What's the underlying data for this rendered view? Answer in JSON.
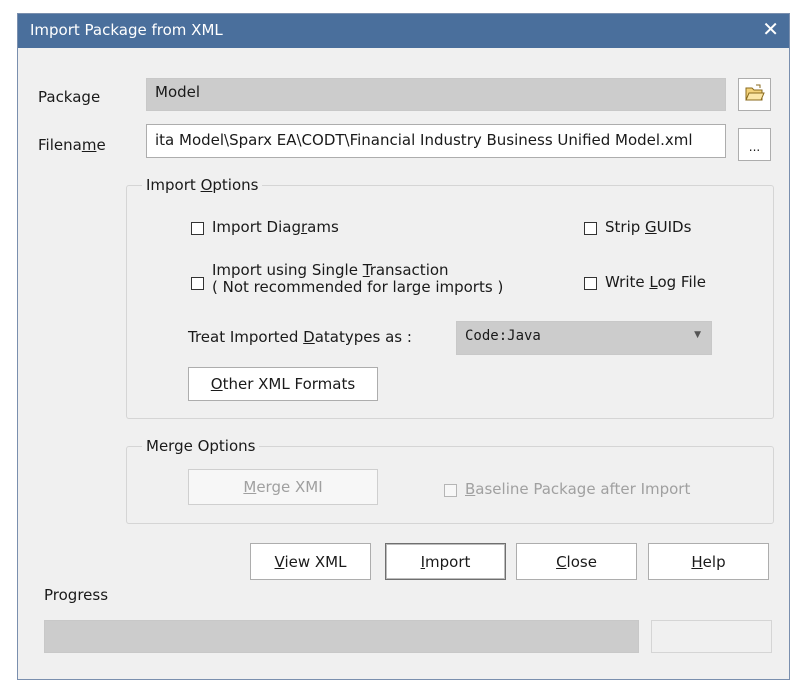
{
  "window": {
    "title": "Import Package from XML",
    "close_glyph": "✕"
  },
  "package": {
    "label": "Package",
    "value": "Model"
  },
  "filename": {
    "label_pre": "Filena",
    "label_u": "m",
    "label_post": "e",
    "value": "ita Model\\Sparx EA\\CODT\\Financial Industry Business Unified Model.xml",
    "browse_label": "..."
  },
  "import_options": {
    "title_pre": "Import ",
    "title_u": "O",
    "title_post": "ptions",
    "import_diagrams": {
      "pre": "Import Diag",
      "u": "r",
      "post": "ams",
      "checked": false
    },
    "strip_guids": {
      "pre": "Strip ",
      "u": "G",
      "post": "UIDs",
      "checked": false
    },
    "single_transaction": {
      "pre": "Import using Single ",
      "u": "T",
      "post": "ransaction",
      "line2": "( Not recommended for large imports )",
      "checked": false
    },
    "write_log": {
      "pre": "Write ",
      "u": "L",
      "post": "og File",
      "checked": false
    },
    "datatypes_label": {
      "pre": "Treat Imported ",
      "u": "D",
      "post": "atatypes as :"
    },
    "datatypes_value": "Code:Java",
    "other_formats": {
      "u": "O",
      "post": "ther XML Formats"
    }
  },
  "merge_options": {
    "title": "Merge Options",
    "merge_xmi": {
      "u": "M",
      "post": "erge XMI"
    },
    "baseline": {
      "u": "B",
      "post": "aseline Package after Import",
      "checked": false
    }
  },
  "buttons": {
    "view_xml": {
      "u": "V",
      "post": "iew XML"
    },
    "import": {
      "u": "I",
      "post": "mport"
    },
    "close": {
      "u": "C",
      "post": "lose"
    },
    "help": {
      "u": "H",
      "post": "elp"
    }
  },
  "progress": {
    "label": "Progress",
    "value": 0
  },
  "colors": {
    "title_bar": "#4a6f9c",
    "dialog_bg": "#f0f0f0",
    "readonly_field": "#cccccc"
  },
  "icons": {
    "folder": "folder-open-icon",
    "dropdown": "chevron-down-icon"
  }
}
